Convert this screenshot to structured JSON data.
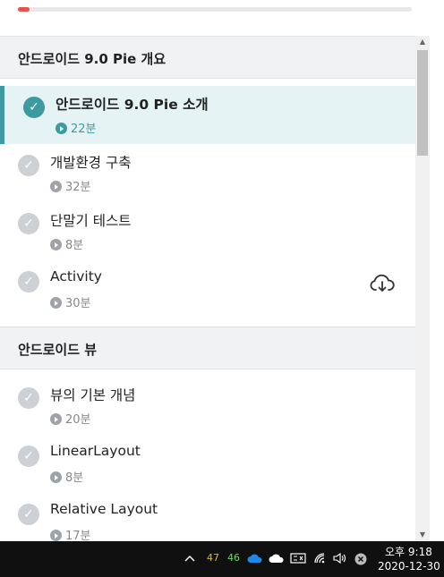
{
  "progress": {
    "percent": 3
  },
  "sections": [
    {
      "title": "안드로이드 9.0 Pie 개요",
      "lessons": [
        {
          "title": "안드로이드 9.0 Pie 소개",
          "duration": "22분",
          "active": true
        },
        {
          "title": "개발환경 구축",
          "duration": "32분"
        },
        {
          "title": "단말기 테스트",
          "duration": "8분"
        },
        {
          "title": "Activity",
          "duration": "30분",
          "download": true
        }
      ]
    },
    {
      "title": "안드로이드 뷰",
      "lessons": [
        {
          "title": "뷰의 기본 개념",
          "duration": "20분"
        },
        {
          "title": "LinearLayout",
          "duration": "8분"
        },
        {
          "title": "Relative Layout",
          "duration": "17분"
        }
      ]
    }
  ],
  "icons": {
    "check": "check-icon",
    "play": "play-icon",
    "download": "cloud-download-icon"
  },
  "taskbar": {
    "temp1": "47",
    "temp2": "46",
    "time": "오후 9:18",
    "date": "2020-12-30"
  },
  "colors": {
    "accent": "#3c9aa0",
    "progress": "#e5534b",
    "section_bg": "#f1f2f4",
    "active_bg": "#e6f3f4"
  }
}
